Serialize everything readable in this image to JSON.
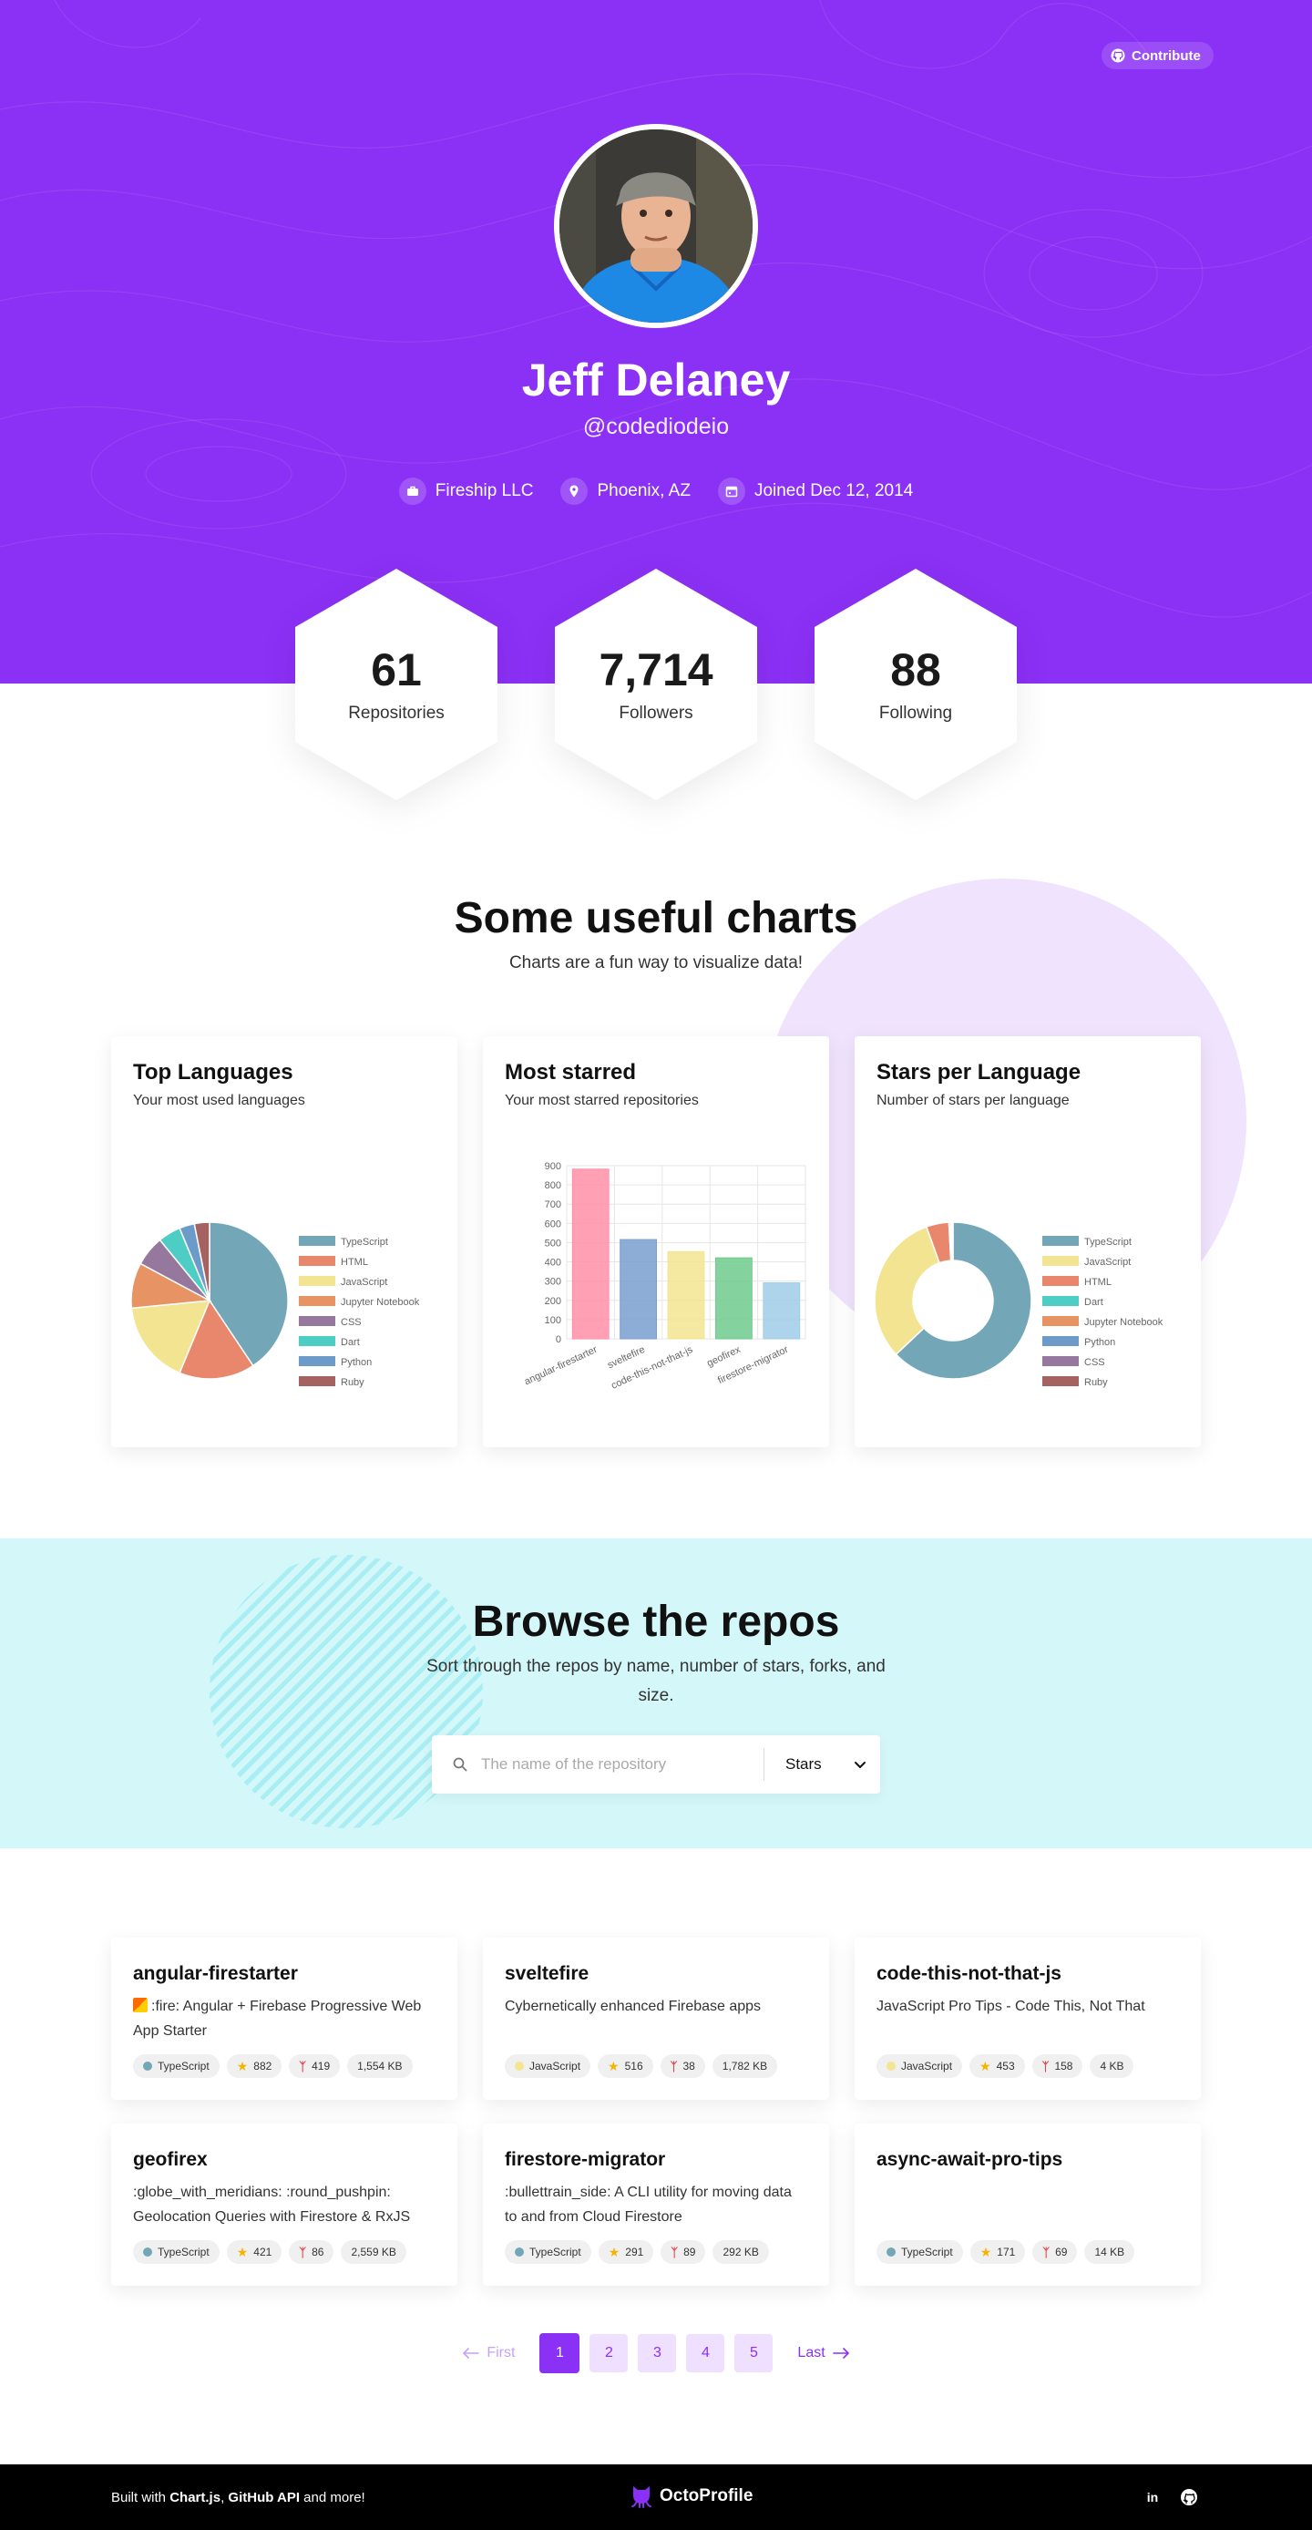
{
  "header": {
    "contribute_label": "Contribute",
    "name": "Jeff Delaney",
    "handle": "@codediodeio",
    "company": "Fireship LLC",
    "location": "Phoenix, AZ",
    "joined": "Joined Dec 12, 2014"
  },
  "stats": [
    {
      "value": "61",
      "label": "Repositories"
    },
    {
      "value": "7,714",
      "label": "Followers"
    },
    {
      "value": "88",
      "label": "Following"
    }
  ],
  "charts_section": {
    "title": "Some useful charts",
    "subtitle": "Charts are a fun way to visualize data!"
  },
  "chart_cards": [
    {
      "title": "Top Languages",
      "subtitle": "Your most used languages"
    },
    {
      "title": "Most starred",
      "subtitle": "Your most starred repositories"
    },
    {
      "title": "Stars per Language",
      "subtitle": "Number of stars per language"
    }
  ],
  "chart_data": [
    {
      "type": "pie",
      "labels": [
        "TypeScript",
        "HTML",
        "JavaScript",
        "Jupyter Notebook",
        "CSS",
        "Dart",
        "Python",
        "Ruby"
      ],
      "values": [
        26,
        10,
        11,
        6,
        4,
        3,
        2,
        2
      ],
      "colors": [
        "#73a7b7",
        "#e8876b",
        "#f3e491",
        "#e79363",
        "#96789f",
        "#4ecdc4",
        "#6c9bc9",
        "#a56261"
      ],
      "legend": "right"
    },
    {
      "type": "bar",
      "categories": [
        "angular-firestarter",
        "sveltefire",
        "code-this-not-that-js",
        "geofirex",
        "firestore-migrator"
      ],
      "values": [
        882,
        516,
        453,
        421,
        291
      ],
      "colors": [
        "#ff8fa7",
        "#7a9fcf",
        "#f3e491",
        "#6fcb8d",
        "#9fcde8"
      ],
      "ylim": [
        0,
        900
      ],
      "yticks": [
        "0",
        "100",
        "200",
        "300",
        "400",
        "500",
        "600",
        "700",
        "800",
        "900"
      ],
      "grid": true
    },
    {
      "type": "doughnut",
      "labels": [
        "TypeScript",
        "JavaScript",
        "HTML",
        "Dart",
        "Jupyter Notebook",
        "Python",
        "CSS",
        "Ruby"
      ],
      "values": [
        1934,
        969,
        143,
        10,
        6,
        5,
        3,
        2
      ],
      "colors": [
        "#73a7b7",
        "#f3e491",
        "#e8876b",
        "#4ecdc4",
        "#e79363",
        "#6c9bc9",
        "#96789f",
        "#a56261"
      ],
      "legend": "right"
    }
  ],
  "browse": {
    "title": "Browse the repos",
    "subtitle": "Sort through the repos by name, number of stars, forks, and size.",
    "search_placeholder": "The name of the repository",
    "sort_value": "Stars"
  },
  "repos": [
    {
      "name": "angular-firestarter",
      "description": ":fire: Angular + Firebase Progressive Web App Starter",
      "language": "TypeScript",
      "lang_color": "#73a7b7",
      "stars": "882",
      "forks": "419",
      "size": "1,554 KB",
      "emoji": true
    },
    {
      "name": "sveltefire",
      "description": "Cybernetically enhanced Firebase apps",
      "language": "JavaScript",
      "lang_color": "#f3e491",
      "stars": "516",
      "forks": "38",
      "size": "1,782 KB"
    },
    {
      "name": "code-this-not-that-js",
      "description": "JavaScript Pro Tips - Code This, Not That",
      "language": "JavaScript",
      "lang_color": "#f3e491",
      "stars": "453",
      "forks": "158",
      "size": "4 KB"
    },
    {
      "name": "geofirex",
      "description": ":globe_with_meridians: :round_pushpin: Geolocation Queries with Firestore & RxJS",
      "language": "TypeScript",
      "lang_color": "#73a7b7",
      "stars": "421",
      "forks": "86",
      "size": "2,559 KB"
    },
    {
      "name": "firestore-migrator",
      "description": ":bullettrain_side: A CLI utility for moving data to and from Cloud Firestore",
      "language": "TypeScript",
      "lang_color": "#73a7b7",
      "stars": "291",
      "forks": "89",
      "size": "292 KB"
    },
    {
      "name": "async-await-pro-tips",
      "description": "",
      "language": "TypeScript",
      "lang_color": "#73a7b7",
      "stars": "171",
      "forks": "69",
      "size": "14 KB"
    }
  ],
  "pagination": {
    "first_label": "First",
    "last_label": "Last",
    "pages": [
      "1",
      "2",
      "3",
      "4",
      "5"
    ],
    "current": "1"
  },
  "footer": {
    "built_prefix": "Built with ",
    "built_chartjs": "Chart.js",
    "built_sep": ", ",
    "built_github": "GitHub API",
    "built_suffix": " and more!",
    "brand": "OctoProfile"
  },
  "colors": {
    "brand_purple": "#8b30f5",
    "browse_bg": "#d4f8fa",
    "deco_circle": "#f0e3fd"
  }
}
